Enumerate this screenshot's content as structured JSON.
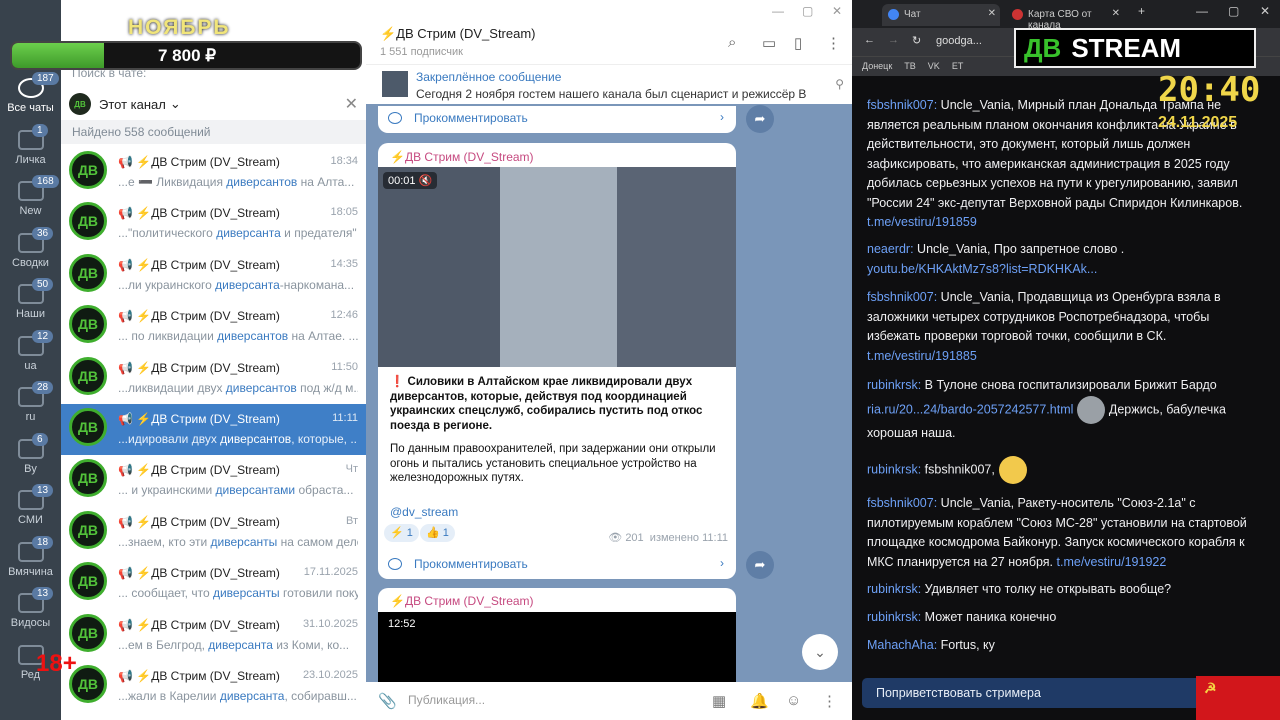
{
  "overlay": {
    "month": "НОЯБРЬ",
    "amount": "7 800 ₽",
    "logo_left": "ДВ",
    "logo_right": "STREAM",
    "clock": "20:40",
    "date": "24.11.2025",
    "age": "18+"
  },
  "rail": {
    "items": [
      {
        "label": "Все чаты",
        "badge": "187"
      },
      {
        "label": "Личка",
        "badge": "1"
      },
      {
        "label": "New",
        "badge": "168"
      },
      {
        "label": "Сводки",
        "badge": "36"
      },
      {
        "label": "Наши",
        "badge": "50"
      },
      {
        "label": "ua",
        "badge": "12"
      },
      {
        "label": "ru",
        "badge": "28"
      },
      {
        "label": "By",
        "badge": "6"
      },
      {
        "label": "СМИ",
        "badge": "13"
      },
      {
        "label": "Вмячина",
        "badge": "18"
      },
      {
        "label": "Видосы",
        "badge": "13"
      },
      {
        "label": "Ред",
        "badge": ""
      }
    ]
  },
  "search": {
    "placeholder": "Поиск в чате:",
    "filter": "Этот канал",
    "found": "Найдено 558 сообщений"
  },
  "results": [
    {
      "title": "📢 ⚡ДВ Стрим (DV_Stream)",
      "date": "18:34",
      "pre": "...е ➖ Ликвидация ",
      "hl": "диверсантов",
      "post": " на Алта..."
    },
    {
      "title": "📢 ⚡ДВ Стрим (DV_Stream)",
      "date": "18:05",
      "pre": "...\"политического ",
      "hl": "диверсанта",
      "post": " и предателя\" ..."
    },
    {
      "title": "📢 ⚡ДВ Стрим (DV_Stream)",
      "date": "14:35",
      "pre": "...ли украинского ",
      "hl": "диверсанта",
      "post": "-наркомана..."
    },
    {
      "title": "📢 ⚡ДВ Стрим (DV_Stream)",
      "date": "12:46",
      "pre": "... по ликвидации ",
      "hl": "диверсантов",
      "post": " на Алтае. ..."
    },
    {
      "title": "📢 ⚡ДВ Стрим (DV_Stream)",
      "date": "11:50",
      "pre": "...ликвидации двух ",
      "hl": "диверсантов",
      "post": " под ж/д м..."
    },
    {
      "title": "📢 ⚡ДВ Стрим (DV_Stream)",
      "date": "11:11",
      "pre": "...идировали двух ",
      "hl": "диверсантов",
      "post": ", которые, ..."
    },
    {
      "title": "📢 ⚡ДВ Стрим (DV_Stream)",
      "date": "Чт",
      "pre": "... и украинскими ",
      "hl": "диверсантами",
      "post": " обраста..."
    },
    {
      "title": "📢 ⚡ДВ Стрим (DV_Stream)",
      "date": "Вт",
      "pre": "...знаем, кто эти ",
      "hl": "диверсанты",
      "post": " на самом деле ..."
    },
    {
      "title": "📢 ⚡ДВ Стрим (DV_Stream)",
      "date": "17.11.2025",
      "pre": "... сообщает, что ",
      "hl": "диверсанты",
      "post": " готовили поку..."
    },
    {
      "title": "📢 ⚡ДВ Стрим (DV_Stream)",
      "date": "31.10.2025",
      "pre": "...ем в Белгрод, ",
      "hl": "диверсанта",
      "post": " из Коми, ко..."
    },
    {
      "title": "📢 ⚡ДВ Стрим (DV_Stream)",
      "date": "23.10.2025",
      "pre": "...жали в Карелии ",
      "hl": "диверсанта",
      "post": ", собиравш..."
    }
  ],
  "chat": {
    "title": "⚡ДВ Стрим (DV_Stream)",
    "subs": "1 551 подписчик",
    "pinned_title": "Закреплённое сообщение",
    "pinned_text": "Сегодня 2 ноября гостем нашего канала был сценарист и режиссёр Вла...",
    "comment": "Прокомментировать",
    "author": "⚡ДВ Стрим (DV_Stream)",
    "video_time": "00:01",
    "text1": "❗ Силовики в Алтайском крае ликвидировали двух диверсантов, которые, действуя под координацией украинских спецслужб, собирались пустить под откос поезда в регионе.",
    "text2": "По данным правоохранителей, при задержании они открыли огонь и пытались установить специальное устройство на железнодорожных путях.",
    "tag": "@dv_stream",
    "react1": "⚡ 1",
    "react2": "👍 1",
    "views": "👁 201",
    "edited": "изменено 11:11",
    "next_author": "⚡ДВ Стрим (DV_Stream)",
    "next_time": "12:52",
    "compose": "Публикация..."
  },
  "browser": {
    "tab1": "Чат",
    "tab2": "Карта СВО от канала",
    "url": "goodga...",
    "bookmarks": [
      "Донецк",
      "ТВ",
      "VK",
      "ЕТ"
    ]
  },
  "twitch": {
    "messages": [
      {
        "user": "fsbshnik007:",
        "text": " Uncle_Vania, Мирный план Дональда Трампа не является реальным планом окончания конфликта на Украине в действительности, это документ, который лишь должен зафиксировать, что американская администрация в 2025 году добилась серьезных успехов на пути к урегулированию, заявил \"России 24\" экс-депутат Верховной рады Спиридон Килинкаров.",
        "link": "t.me/vestiru/191859"
      },
      {
        "user": "neaerdr:",
        "text": " Uncle_Vania, Про запретное слово .",
        "link": "youtu.be/KHKAktMz7s8?list=RDKHKAk..."
      },
      {
        "user": "fsbshnik007:",
        "text": " Uncle_Vania, Продавщица из Оренбурга взяла в заложники четырех сотрудников Роспотребнадзора, чтобы избежать проверки торговой точки, сообщили в СК.",
        "link": "t.me/vestiru/191885"
      },
      {
        "user": "rubinkrsk:",
        "text": " В Тулоне снова госпитализировали Брижит Бардо",
        "link": "ria.ru/20...24/bardo-2057242577.html",
        "tail": " Держись, бабулечка хорошая наша."
      },
      {
        "user": "rubinkrsk:",
        "text": " fsbshnik007,",
        "link": ""
      },
      {
        "user": "fsbshnik007:",
        "text": " Uncle_Vania, Ракету-носитель \"Союз-2.1а\" с пилотируемым кораблем \"Союз МС-28\" установили на стартовой площадке космодрома Байконур. Запуск космического корабля к МКС планируется на 27 ноября.",
        "link": "t.me/vestiru/191922"
      },
      {
        "user": "rubinkrsk:",
        "text": " Удивляет что толку не открывать вообще?",
        "link": ""
      },
      {
        "user": "rubinkrsk:",
        "text": " Может паника конечно",
        "link": ""
      },
      {
        "user": "MahachAha:",
        "text": " Fortus, ку",
        "link": ""
      }
    ],
    "greet": "Поприветствовать стримера"
  }
}
